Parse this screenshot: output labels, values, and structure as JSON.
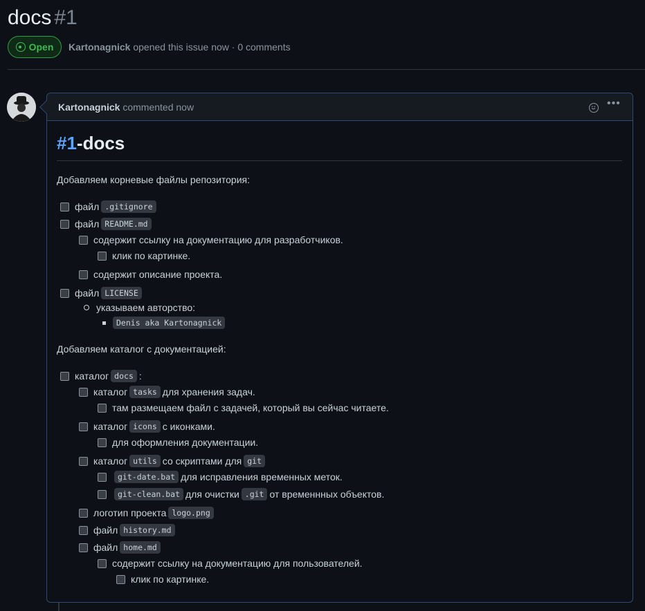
{
  "issue": {
    "title": "docs",
    "number": "#1",
    "status": "Open",
    "author": "Kartonagnick",
    "meta_rest": "opened this issue now · 0 comments"
  },
  "comment": {
    "author": "Kartonagnick",
    "action": "commented now",
    "heading_num": "#1",
    "heading_rest": "-docs",
    "para1": "Добавляем корневые файлы репозитория:",
    "para2": "Добавляем каталог с документацией:",
    "colors": {
      "accent": "#58a6ff",
      "open_green": "#3fb950"
    }
  },
  "checklist1": [
    {
      "pre": "файл",
      "code": ".gitignore"
    },
    {
      "pre": "файл",
      "code": "README.md"
    },
    {
      "text": "содержит ссылку на документацию для разработчиков."
    },
    {
      "text": "клик по картинке."
    },
    {
      "text": "содержит описание проекта."
    },
    {
      "pre": "файл",
      "code": "LICENSE"
    },
    {
      "text": "указываем авторство:"
    },
    {
      "code": "Denis aka Kartonagnick"
    }
  ],
  "checklist2": [
    {
      "pre": "каталог",
      "code": "docs",
      "post": ":"
    },
    {
      "pre": "каталог",
      "code": "tasks",
      "post": "для хранения задач."
    },
    {
      "text": "там размещаем файл с задачей, который вы сейчас читаете."
    },
    {
      "pre": "каталог",
      "code": "icons",
      "post": "с иконками."
    },
    {
      "text": "для оформления документации."
    },
    {
      "pre": "каталог",
      "code": "utils",
      "post": "со скриптами для",
      "code2": "git"
    },
    {
      "code": "git-date.bat",
      "post": "для исправления временных меток."
    },
    {
      "code": "git-clean.bat",
      "post": "для очистки",
      "code2": ".git",
      "post2": "от временнных объектов."
    },
    {
      "pre": "логотип проекта",
      "code": "logo.png"
    },
    {
      "pre": "файл",
      "code": "history.md"
    },
    {
      "pre": "файл",
      "code": "home.md"
    },
    {
      "text": "содержит ссылку на документацию для пользователей."
    },
    {
      "text": "клик по картинке."
    }
  ],
  "icons": [
    "issue-open-icon",
    "smiley-icon",
    "kebab-menu-icon",
    "avatar"
  ]
}
